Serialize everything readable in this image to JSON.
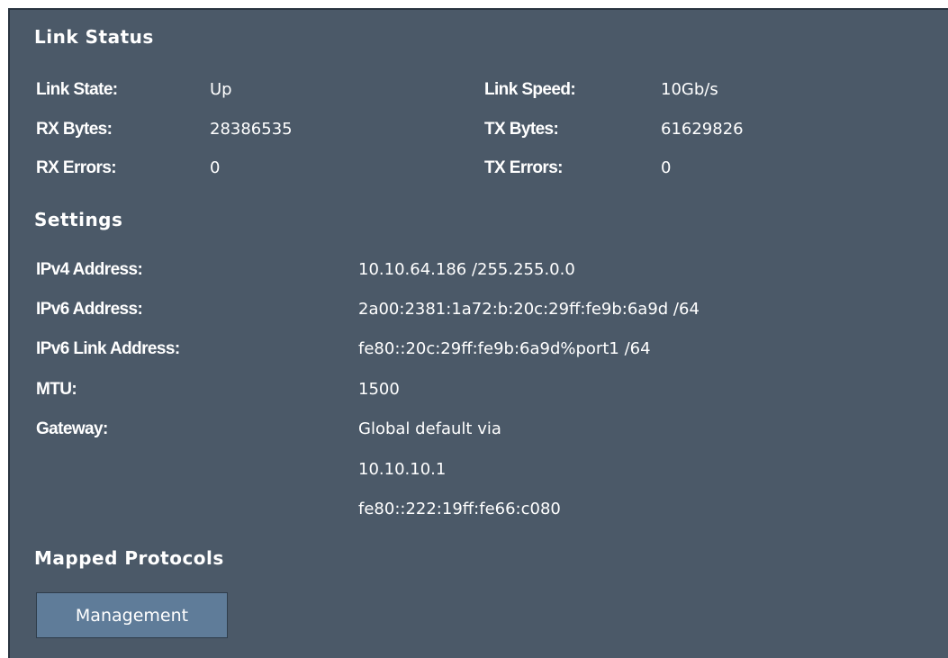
{
  "link_status": {
    "title": "Link Status",
    "link_state_label": "Link State:",
    "link_state_value": "Up",
    "link_speed_label": "Link Speed:",
    "link_speed_value": "10Gb/s",
    "rx_bytes_label": "RX Bytes:",
    "rx_bytes_value": "28386535",
    "tx_bytes_label": "TX Bytes:",
    "tx_bytes_value": "61629826",
    "rx_errors_label": "RX Errors:",
    "rx_errors_value": "0",
    "tx_errors_label": "TX Errors:",
    "tx_errors_value": "0"
  },
  "settings": {
    "title": "Settings",
    "ipv4_label": "IPv4 Address:",
    "ipv4_value": "10.10.64.186 /255.255.0.0",
    "ipv6_label": "IPv6 Address:",
    "ipv6_value": "2a00:2381:1a72:b:20c:29ff:fe9b:6a9d /64",
    "ipv6_link_label": "IPv6 Link Address:",
    "ipv6_link_value": "fe80::20c:29ff:fe9b:6a9d%port1 /64",
    "mtu_label": "MTU:",
    "mtu_value": "1500",
    "gateway_label": "Gateway:",
    "gateway_lines": [
      "Global default via",
      "10.10.10.1",
      "fe80::222:19ff:fe66:c080"
    ]
  },
  "mapped_protocols": {
    "title": "Mapped Protocols",
    "buttons": [
      "Management"
    ]
  },
  "colors": {
    "panel_bg": "#4b5968",
    "button_bg": "#5f7c99",
    "text": "#ffffff"
  }
}
